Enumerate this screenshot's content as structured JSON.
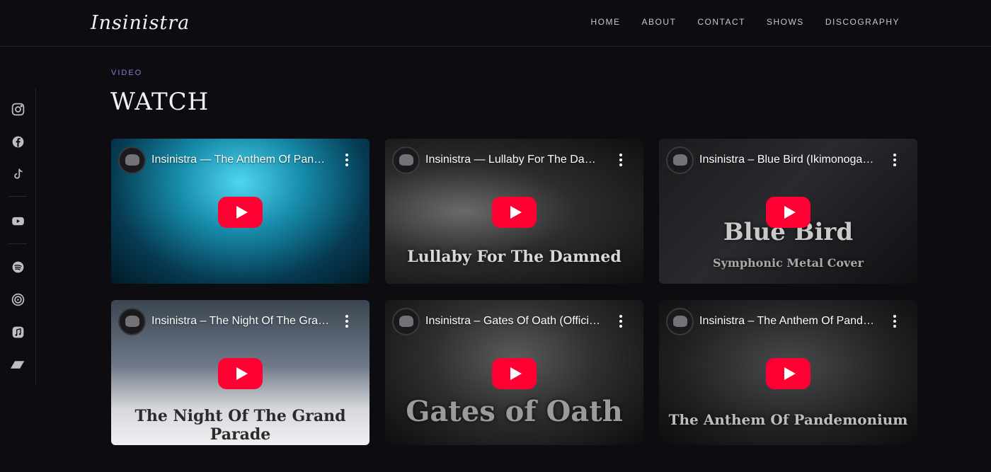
{
  "brand": {
    "logo_text": "Insinistra"
  },
  "nav": {
    "items": [
      {
        "label": "HOME"
      },
      {
        "label": "ABOUT"
      },
      {
        "label": "CONTACT"
      },
      {
        "label": "SHOWS"
      },
      {
        "label": "DISCOGRAPHY"
      }
    ]
  },
  "social": {
    "icons": [
      "instagram-icon",
      "facebook-icon",
      "tiktok-icon",
      "youtube-icon",
      "spotify-icon",
      "youtube-music-icon",
      "apple-music-icon",
      "bandcamp-icon"
    ]
  },
  "section": {
    "kicker": "VIDEO",
    "title": "WATCH"
  },
  "videos": [
    {
      "title": "Insinistra — The Anthem Of Pandemonium",
      "overlay": ""
    },
    {
      "title": "Insinistra — Lullaby For The Damned",
      "overlay": "Lullaby For The Damned"
    },
    {
      "title": "Insinistra – Blue Bird (Ikimonogakari)",
      "overlay": "Blue Bird",
      "overlay_sub": "Symphonic Metal Cover"
    },
    {
      "title": "Insinistra – The Night Of The Grand Parade",
      "overlay": "The Night Of The Grand Parade"
    },
    {
      "title": "Insinistra – Gates Of Oath (Official Video)",
      "overlay": "Gates of Oath"
    },
    {
      "title": "Insinistra – The Anthem Of Pandemonium",
      "overlay": "The Anthem Of Pandemonium"
    }
  ],
  "colors": {
    "background": "#0c0c11",
    "accent": "#8f7bd1",
    "play": "#ff0033"
  }
}
